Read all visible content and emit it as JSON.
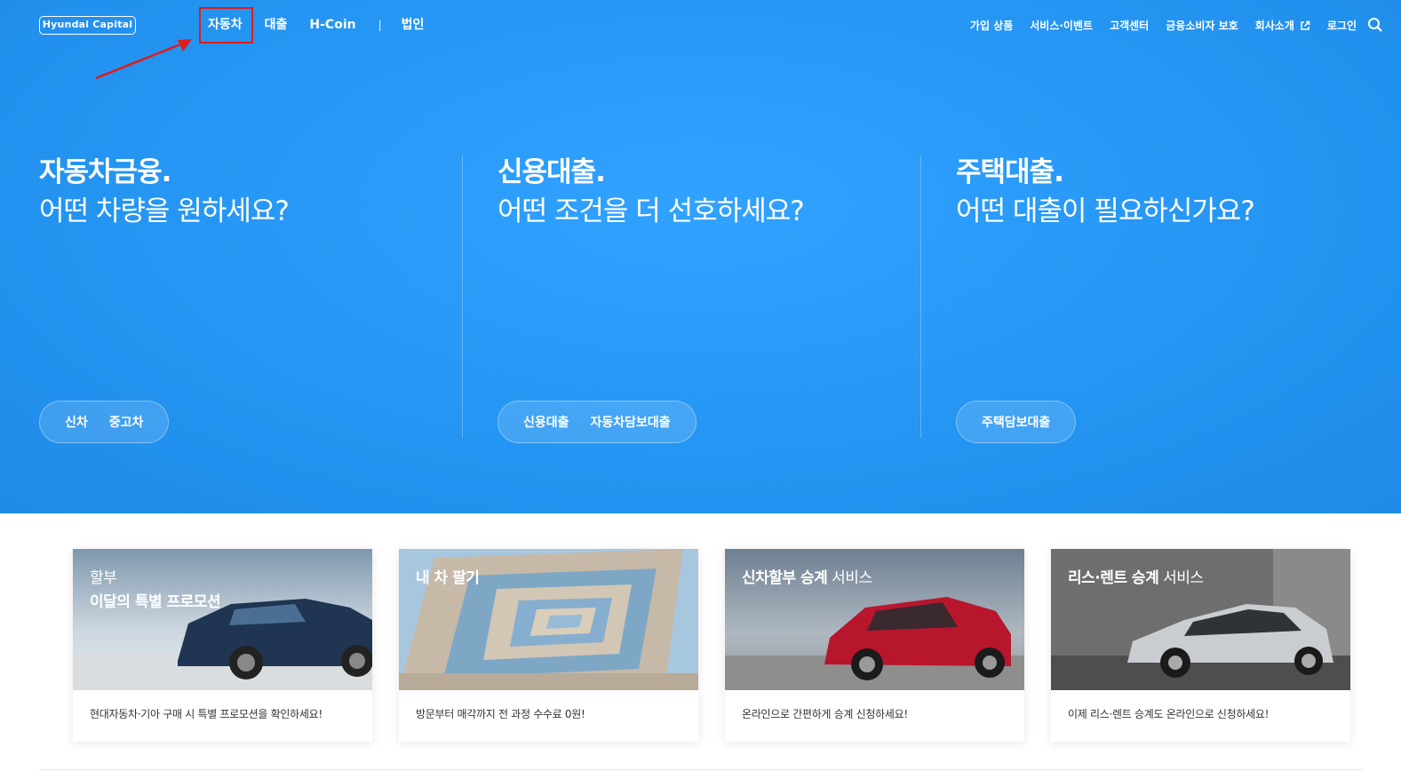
{
  "header": {
    "logo_text": "Hyundai Capital",
    "gnb": [
      "자동차",
      "대출",
      "H-Coin"
    ],
    "gnb_separator": "|",
    "gnb_last": "법인",
    "util": [
      "가입 상품",
      "서비스·이벤트",
      "고객센터",
      "금융소비자 보호",
      "회사소개",
      "로그인"
    ]
  },
  "sections": [
    {
      "title": "자동차금융.",
      "subtitle": "어떤 차량을 원하세요?",
      "buttons": [
        "신차",
        "중고차"
      ]
    },
    {
      "title": "신용대출.",
      "subtitle": "어떤 조건을 더 선호하세요?",
      "buttons": [
        "신용대출",
        "자동차담보대출"
      ]
    },
    {
      "title": "주택대출.",
      "subtitle": "어떤 대출이 필요하신가요?",
      "buttons": [
        "주택담보대출"
      ]
    }
  ],
  "cards": [
    {
      "title_line1": "할부",
      "title_line2_bold": "이달의 특별 프로모션",
      "desc": "현대자동차·기아 구매 시 특별 프로모션을 확인하세요!"
    },
    {
      "title_bold": "내 차 팔기",
      "desc": "방문부터 매각까지 전 과정 수수료 0원!"
    },
    {
      "title_bold": "신차할부 승계",
      "title_rest": " 서비스",
      "desc": "온라인으로 간편하게 승계 신청하세요!"
    },
    {
      "title_bold": "리스·렌트 승계",
      "title_rest": " 서비스",
      "desc": "이제 리스·렌트 승계도 온라인으로 신청하세요!"
    }
  ],
  "colors": {
    "hero_blue": "#2596f3",
    "highlight_red": "#e01c1c"
  }
}
